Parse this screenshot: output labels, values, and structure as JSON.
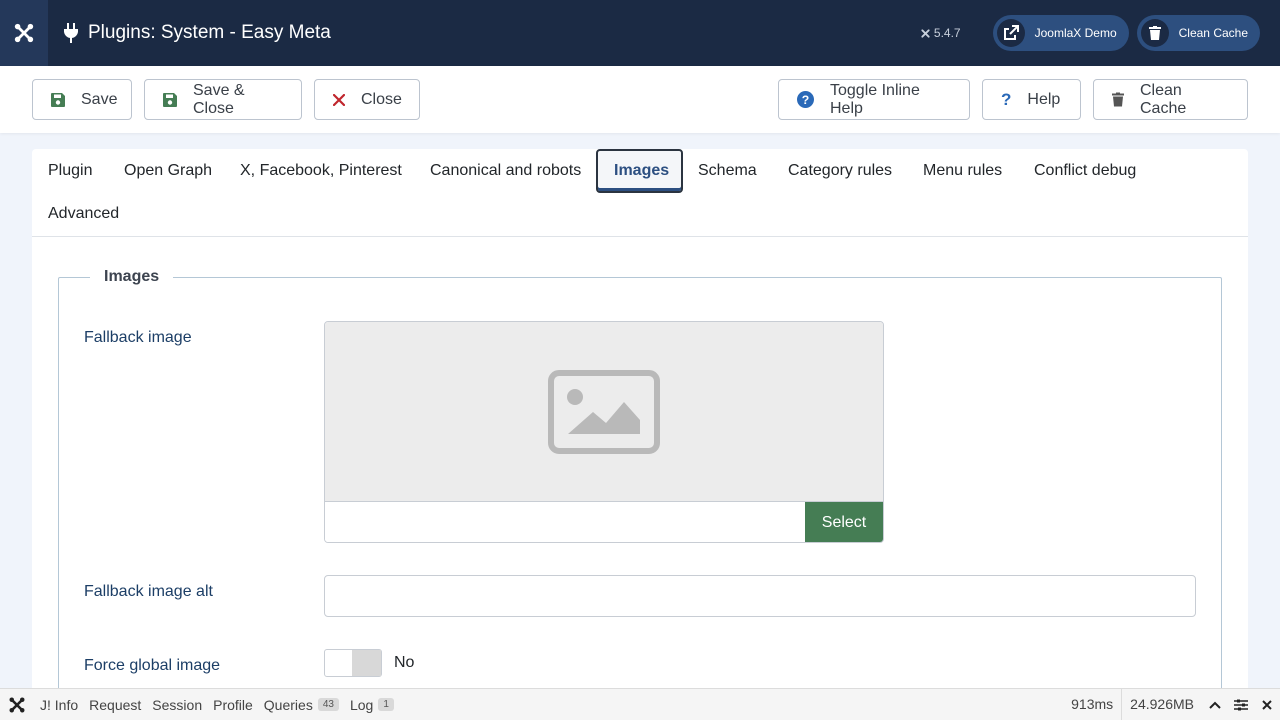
{
  "header": {
    "title": "Plugins: System - Easy Meta",
    "version": "5.4.7",
    "site_button": "JoomlaX Demo",
    "cache_button": "Clean Cache"
  },
  "toolbar": {
    "save": "Save",
    "save_close": "Save & Close",
    "close": "Close",
    "toggle_help": "Toggle Inline Help",
    "help": "Help",
    "clean_cache": "Clean Cache"
  },
  "tabs": [
    "Plugin",
    "Open Graph",
    "X, Facebook, Pinterest",
    "Canonical and robots",
    "Images",
    "Schema",
    "Category rules",
    "Menu rules",
    "Conflict debug",
    "Advanced"
  ],
  "active_tab": "Images",
  "form": {
    "legend": "Images",
    "fallback_image_label": "Fallback image",
    "select_button": "Select",
    "fallback_image_path": "",
    "fallback_alt_label": "Fallback image alt",
    "fallback_alt_value": "",
    "force_global_label": "Force global image",
    "force_global_value": "No"
  },
  "debugbar": {
    "items": [
      {
        "label": "J! Info"
      },
      {
        "label": "Request"
      },
      {
        "label": "Session"
      },
      {
        "label": "Profile"
      },
      {
        "label": "Queries",
        "badge": "43"
      },
      {
        "label": "Log",
        "badge": "1"
      }
    ],
    "time": "913ms",
    "memory": "24.926MB"
  },
  "colors": {
    "header_bg": "#1b2a44",
    "accent": "#2c4f81",
    "select_button": "#457d54",
    "close_icon": "#c0262d",
    "save_icon": "#457d54",
    "help_icon": "#2a69b8"
  }
}
